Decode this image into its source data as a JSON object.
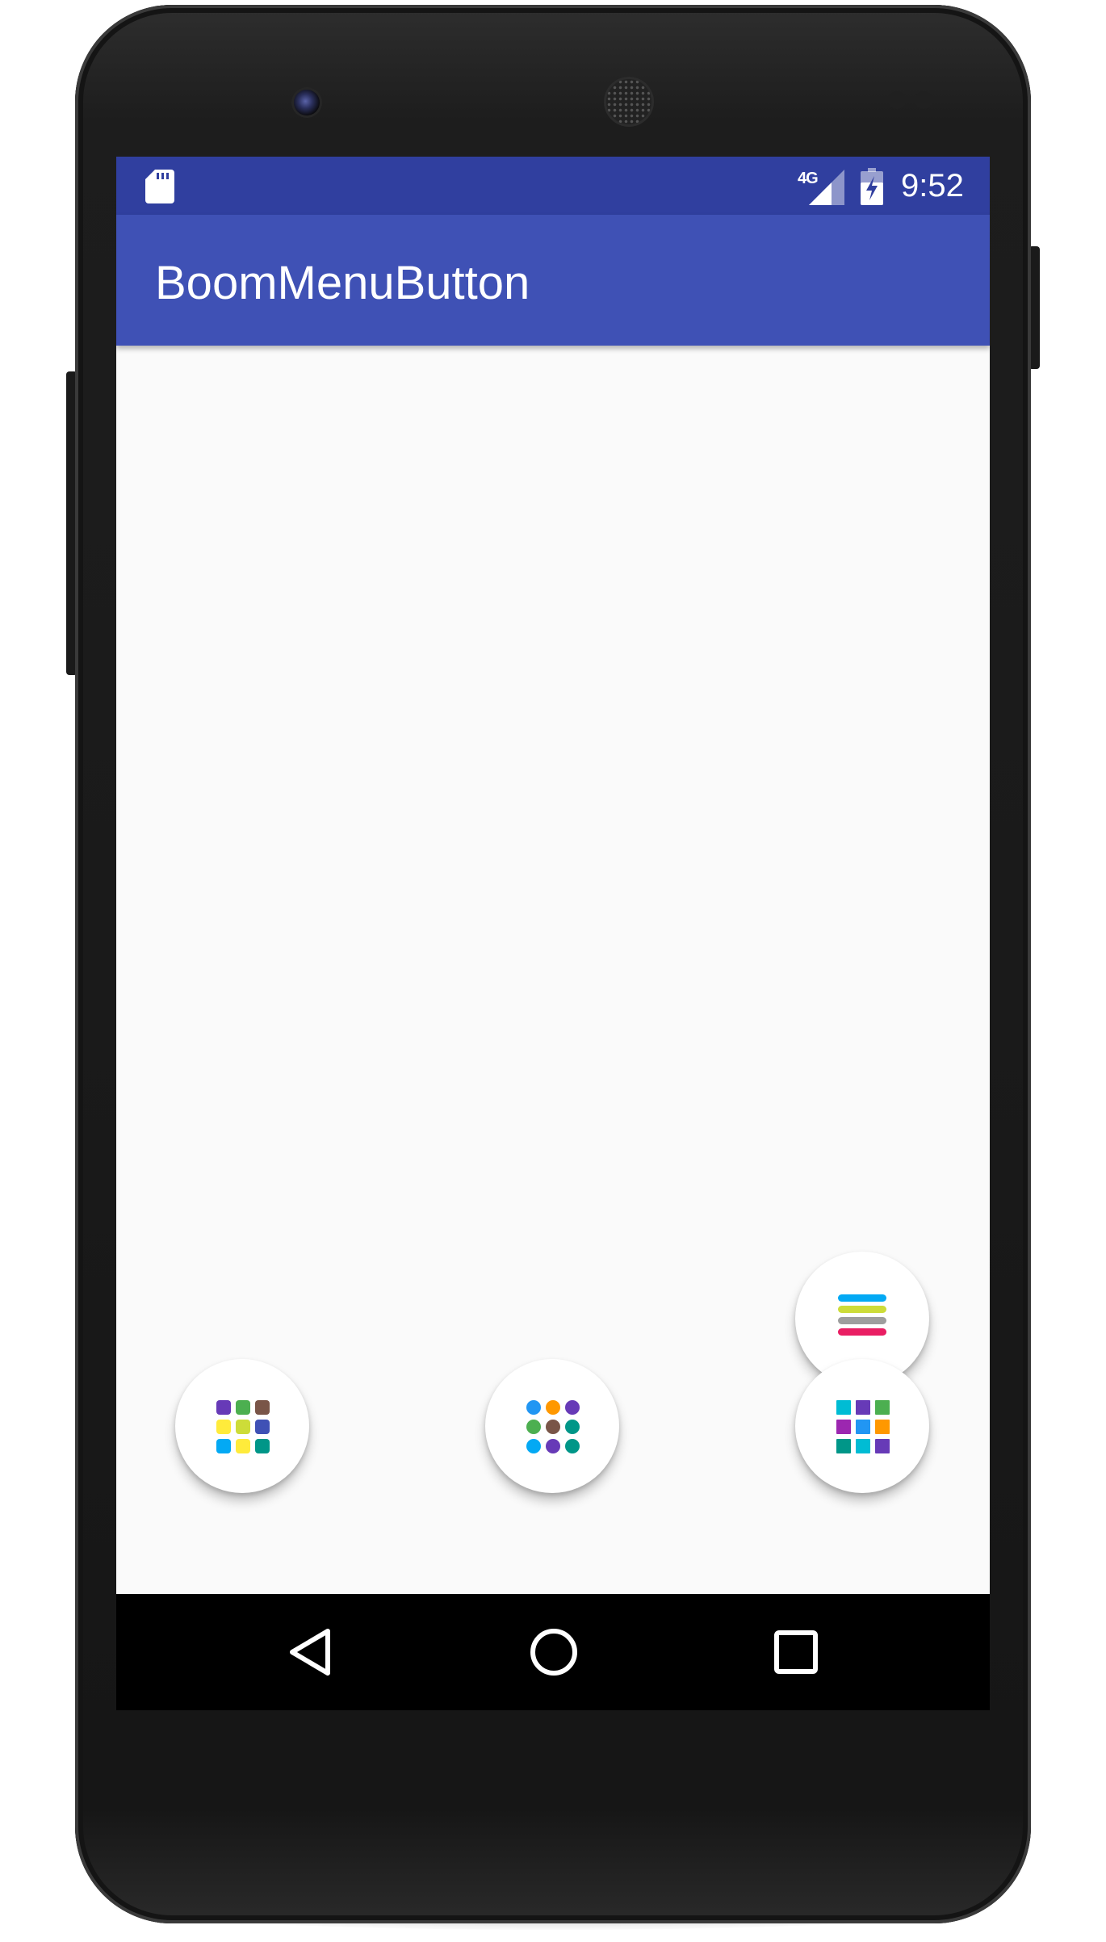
{
  "status_bar": {
    "network_type": "4G",
    "time": "9:52",
    "icons": [
      "sd-card-icon",
      "signal-icon",
      "battery-charging-icon"
    ]
  },
  "app_bar": {
    "title": "BoomMenuButton"
  },
  "boom_buttons": [
    {
      "name": "boom-menu-button-hamburger",
      "icon": "hamburger-icon",
      "colors": [
        "#03a9f4",
        "#cddc39",
        "#9e9e9e",
        "#e91e63"
      ]
    },
    {
      "name": "boom-menu-button-grid-1",
      "icon": "dot-grid-icon",
      "colors": [
        "#673ab7",
        "#4caf50",
        "#795548",
        "#ffeb3b",
        "#cddc39",
        "#3f51b5",
        "#03a9f4",
        "#ffeb3b",
        "#009688"
      ]
    },
    {
      "name": "boom-menu-button-grid-2",
      "icon": "dot-grid-icon",
      "colors": [
        "#2196f3",
        "#ff9800",
        "#673ab7",
        "#4caf50",
        "#795548",
        "#009688",
        "#03a9f4",
        "#673ab7",
        "#009688"
      ]
    },
    {
      "name": "boom-menu-button-grid-3",
      "icon": "dot-grid-icon",
      "colors": [
        "#00bcd4",
        "#673ab7",
        "#4caf50",
        "#9c27b0",
        "#2196f3",
        "#ff9800",
        "#009688",
        "#00bcd4",
        "#673ab7"
      ]
    }
  ],
  "nav_bar": {
    "icons": [
      "back-icon",
      "home-icon",
      "recent-apps-icon"
    ]
  },
  "colors": {
    "status_bar": "#303f9f",
    "app_bar": "#3f51b5",
    "content_background": "#fafafa",
    "nav_bar": "#000000"
  }
}
